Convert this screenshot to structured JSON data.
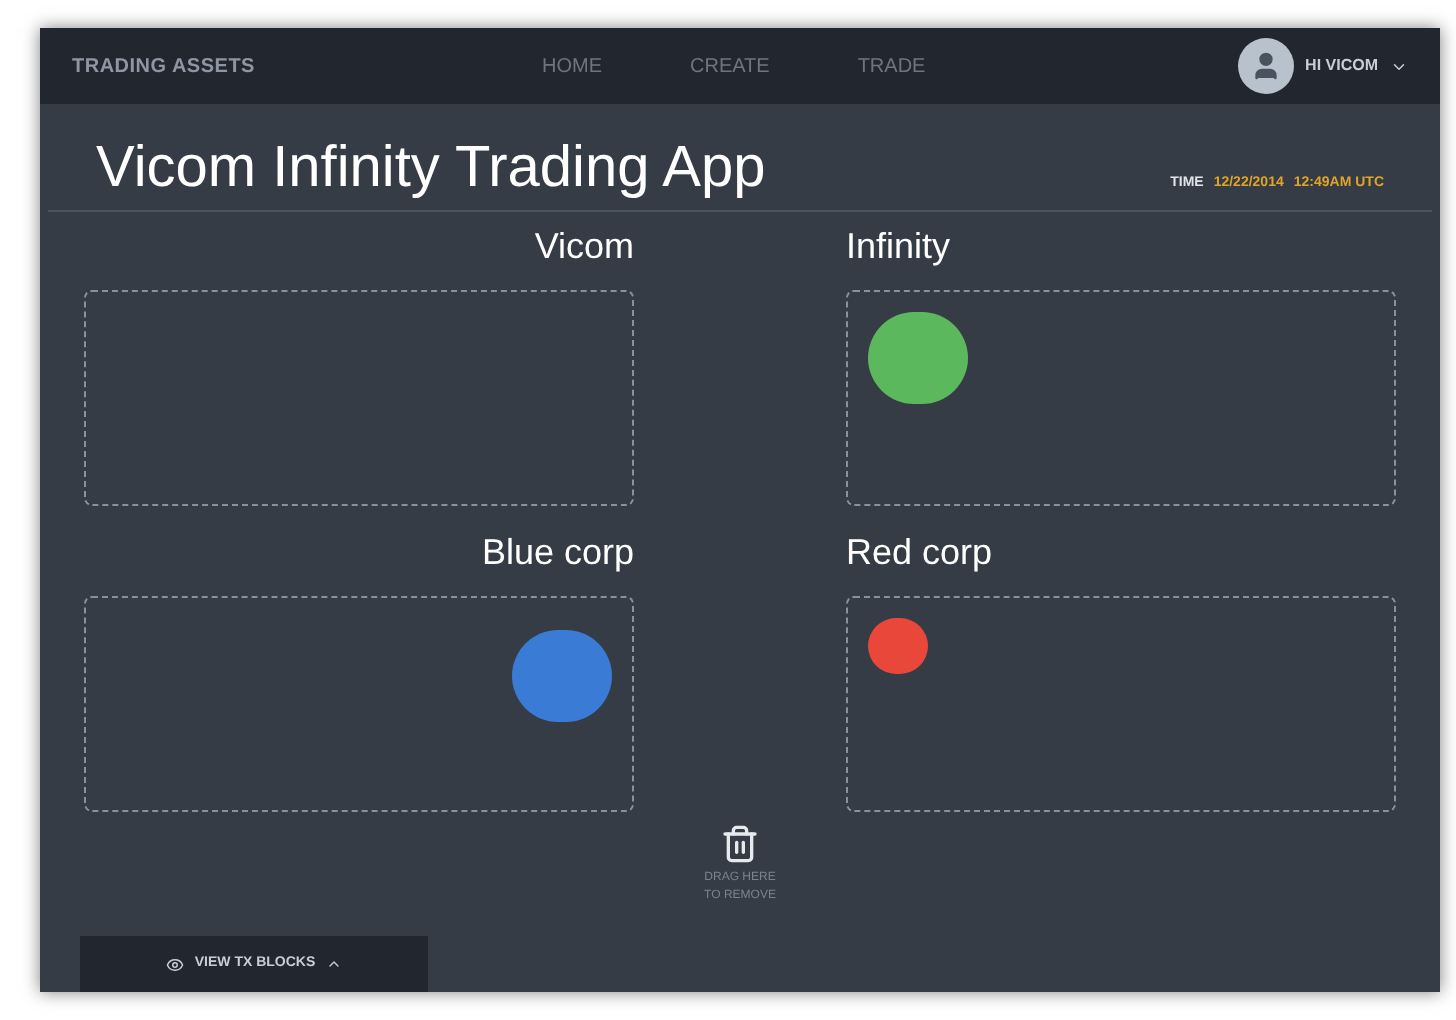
{
  "nav": {
    "brand": "TRADING ASSETS",
    "links": [
      {
        "label": "HOME",
        "selected": false
      },
      {
        "label": "CREATE",
        "selected": false
      },
      {
        "label": "TRADE",
        "selected": false
      }
    ],
    "user": "HI VICOM"
  },
  "title": "Vicom Infinity Trading App",
  "time": {
    "label": "TIME",
    "date": "12/22/2014",
    "clock": "12:49AM UTC"
  },
  "panels": [
    {
      "name": "Vicom"
    },
    {
      "name": "Infinity",
      "assets": [
        {
          "color": "#5cb85c",
          "kind": "large"
        }
      ]
    },
    {
      "name": "Blue corp",
      "assets": [
        {
          "color": "#3a7bd5",
          "kind": "large"
        }
      ]
    },
    {
      "name": "Red corp",
      "assets": [
        {
          "color": "#e8473a",
          "kind": "small"
        }
      ]
    }
  ],
  "trash": {
    "line1": "DRAG HERE",
    "line2": "TO REMOVE"
  },
  "footer_tab": "VIEW TX BLOCKS"
}
